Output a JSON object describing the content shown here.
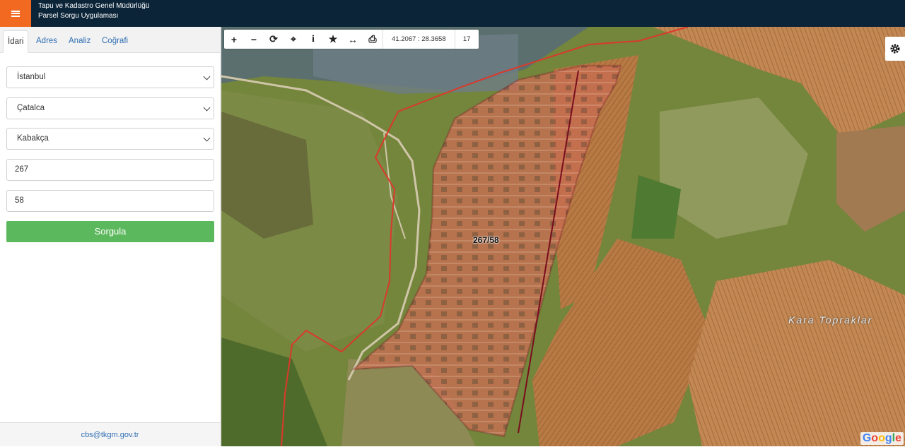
{
  "header": {
    "title_line1": "Tapu ve Kadastro Genel Müdürlüğü",
    "title_line2": "Parsel Sorgu Uygulaması",
    "menu_icon": "hamburger-icon"
  },
  "tabs": [
    {
      "label": "İdari",
      "active": true
    },
    {
      "label": "Adres",
      "active": false
    },
    {
      "label": "Analiz",
      "active": false
    },
    {
      "label": "Coğrafi",
      "active": false
    }
  ],
  "form": {
    "il": "İstanbul",
    "ilce": "Çatalca",
    "mahalle": "Kabakça",
    "ada": "267",
    "parsel": "58",
    "submit_label": "Sorgula"
  },
  "footer": {
    "email": "cbs@tkgm.gov.tr"
  },
  "toolbar": {
    "icons": [
      "zoom-in-icon",
      "zoom-out-icon",
      "refresh-icon",
      "locate-icon",
      "info-icon",
      "favorite-icon",
      "measure-icon",
      "print-icon"
    ],
    "coordinates": "41.2067 : 28.3658",
    "zoom_level": "17"
  },
  "map": {
    "parcel_label": "267/58",
    "place_label": "Kara Topraklar",
    "attribution": "Google",
    "settings_icon": "gear-icon",
    "colors": {
      "parcel_stroke": "#7a0d1e",
      "parcel_fill": "#e8795a",
      "boundary_line": "#d93a2b",
      "header_bg": "#0b2438",
      "menu_accent": "#f26a21",
      "submit_green": "#5cb85c"
    }
  }
}
